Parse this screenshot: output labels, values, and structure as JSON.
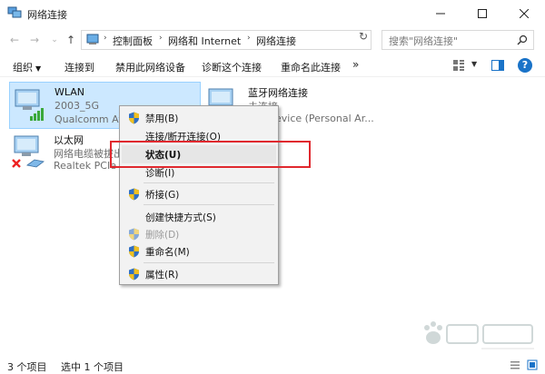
{
  "window": {
    "title": "网络连接"
  },
  "address": {
    "crumbs": [
      "控制面板",
      "网络和 Internet",
      "网络连接"
    ]
  },
  "search": {
    "placeholder": "搜索\"网络连接\""
  },
  "commands": {
    "organize": "组织",
    "connect_to": "连接到",
    "disable_device": "禁用此网络设备",
    "diagnose": "诊断这个连接",
    "rename": "重命名此连接",
    "more": "»"
  },
  "items": [
    {
      "name": "WLAN",
      "status": "2003_5G",
      "device": "Qualcomm Ath",
      "selected": true
    },
    {
      "name": "以太网",
      "status": "网络电缆被拔出",
      "device": "Realtek PCIe G",
      "selected": false
    },
    {
      "name": "蓝牙网络连接",
      "status": "未连接",
      "device": "oth Device (Personal Ar...",
      "selected": false
    }
  ],
  "context_menu": {
    "items": [
      {
        "label": "禁用(B)",
        "shield": true,
        "disabled": false,
        "bold": false
      },
      {
        "label": "连接/断开连接(O)",
        "shield": false,
        "disabled": false,
        "bold": false
      },
      {
        "label": "状态(U)",
        "shield": false,
        "disabled": false,
        "bold": true
      },
      {
        "label": "诊断(I)",
        "shield": false,
        "disabled": false,
        "bold": false
      },
      {
        "label": "桥接(G)",
        "shield": true,
        "disabled": false,
        "bold": false
      },
      {
        "label": "创建快捷方式(S)",
        "shield": false,
        "disabled": false,
        "bold": false
      },
      {
        "label": "删除(D)",
        "shield": true,
        "disabled": true,
        "bold": false
      },
      {
        "label": "重命名(M)",
        "shield": true,
        "disabled": false,
        "bold": false
      },
      {
        "label": "属性(R)",
        "shield": true,
        "disabled": false,
        "bold": false
      }
    ]
  },
  "statusbar": {
    "item_count": "3 个项目",
    "selected_count": "选中 1 个项目"
  },
  "colors": {
    "accent": "#0078d7",
    "selection": "#cce8ff",
    "highlight_frame": "#e0282e"
  }
}
